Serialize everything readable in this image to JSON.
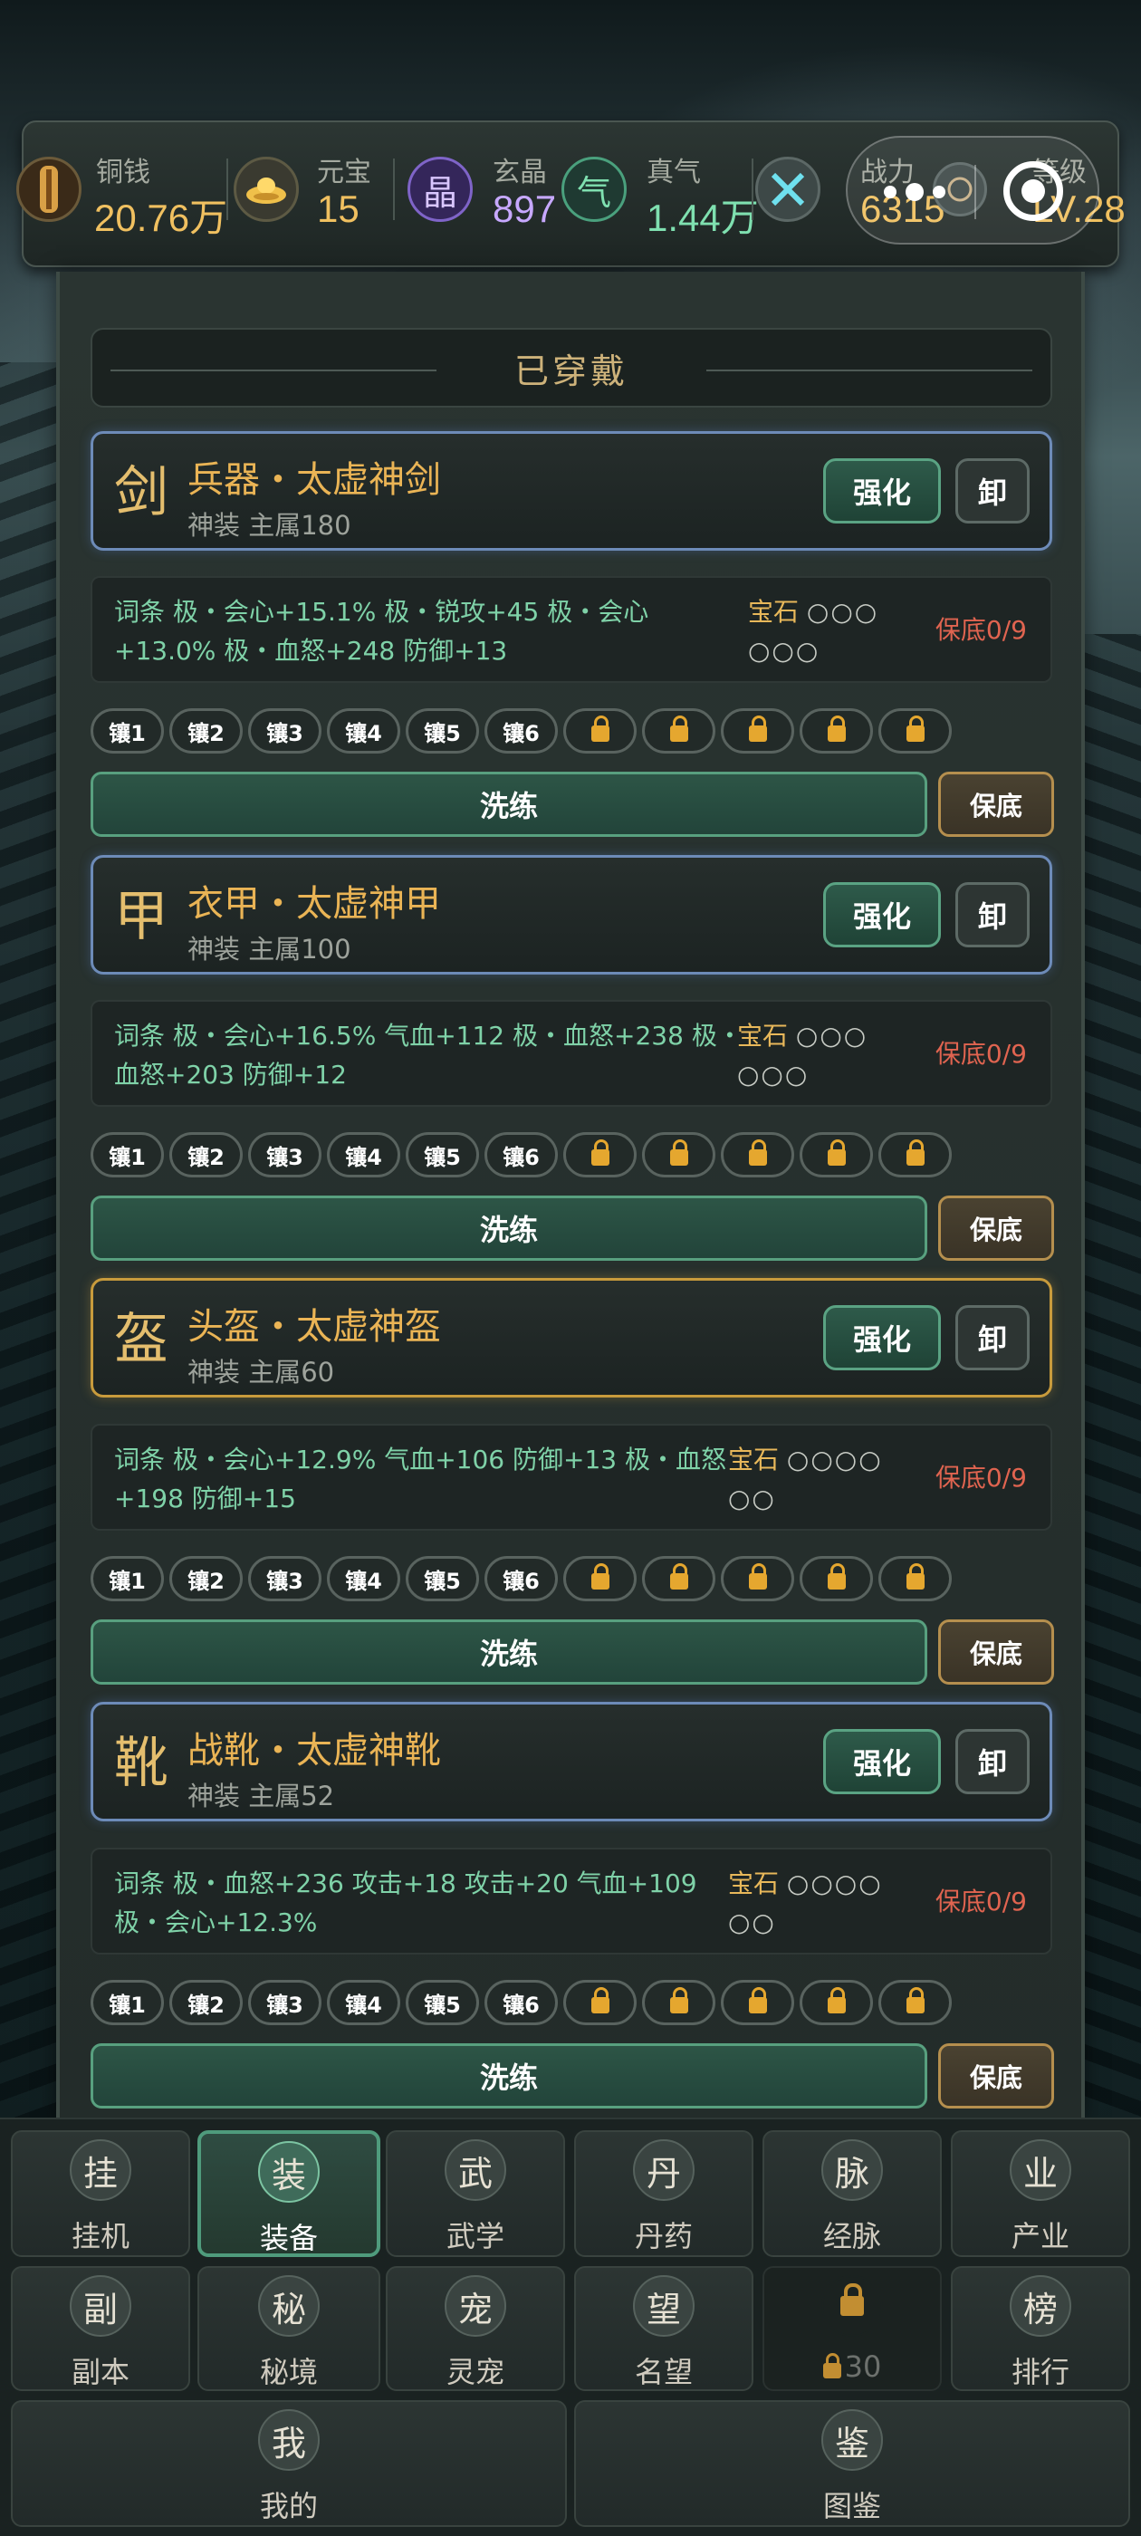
{
  "resources": [
    {
      "name": "铜钱",
      "value": "20.76万",
      "icon": "copper-coin-icon",
      "color": "#f0c060"
    },
    {
      "name": "元宝",
      "value": "15",
      "icon": "gold-ingot-icon",
      "color": "#f0c060"
    },
    {
      "name": "玄晶",
      "value": "897",
      "icon": "crystal-icon",
      "icon_text": "晶",
      "color": "#c7a8ff"
    },
    {
      "name": "真气",
      "value": "1.44万",
      "icon": "qi-icon",
      "icon_text": "气",
      "color": "#7fe0b0"
    },
    {
      "name": "战力",
      "value": "6315",
      "icon": "crossed-swords-icon",
      "color": "#f0c060"
    },
    {
      "name": "等级",
      "value": "LV.28",
      "icon": "level-icon",
      "color": "#f0c060"
    }
  ],
  "section_title": "已穿戴",
  "items": [
    {
      "glyph": "剑",
      "name": "兵器・太虚神剑",
      "sub": "神装 主属180",
      "border": "blue",
      "stats": "词条 极・会心+15.1% 极・锐攻+45 极・会心+13.0% 极・血怒+248 防御+13",
      "gem_label": "宝石",
      "gems": "○○○ ○○○",
      "floor": "保底0/9"
    },
    {
      "glyph": "甲",
      "name": "衣甲・太虚神甲",
      "sub": "神装 主属100",
      "border": "blue",
      "stats": "词条 极・会心+16.5% 气血+112 极・血怒+238 极・血怒+203 防御+12",
      "gem_label": "宝石",
      "gems": "○○○ ○○○",
      "floor": "保底0/9"
    },
    {
      "glyph": "盔",
      "name": "头盔・太虚神盔",
      "sub": "神装 主属60",
      "border": "gold",
      "stats": "词条 极・会心+12.9% 气血+106 防御+13 极・血怒+198 防御+15",
      "gem_label": "宝石",
      "gems": "○○○○ ○○",
      "floor": "保底0/9"
    },
    {
      "glyph": "靴",
      "name": "战靴・太虚神靴",
      "sub": "神装 主属52",
      "border": "blue",
      "stats": "词条 极・血怒+236 攻击+18 攻击+20 气血+109 极・会心+12.3%",
      "gem_label": "宝石",
      "gems": "○○○○ ○○",
      "floor": "保底0/9"
    }
  ],
  "buttons": {
    "enhance": "强化",
    "unequip": "卸",
    "wash": "洗练",
    "guarantee": "保底"
  },
  "slots": [
    "镶1",
    "镶2",
    "镶3",
    "镶4",
    "镶5",
    "镶6"
  ],
  "nav": [
    {
      "icon": "挂",
      "label": "挂机"
    },
    {
      "icon": "装",
      "label": "装备",
      "active": true
    },
    {
      "icon": "武",
      "label": "武学"
    },
    {
      "icon": "丹",
      "label": "丹药"
    },
    {
      "icon": "脉",
      "label": "经脉"
    },
    {
      "icon": "业",
      "label": "产业"
    },
    {
      "icon": "副",
      "label": "副本"
    },
    {
      "icon": "秘",
      "label": "秘境"
    },
    {
      "icon": "宠",
      "label": "灵宠"
    },
    {
      "icon": "望",
      "label": "名望"
    },
    {
      "icon": "",
      "label": "30",
      "locked": true
    },
    {
      "icon": "榜",
      "label": "排行"
    },
    {
      "icon": "我",
      "label": "我的"
    },
    {
      "icon": "鉴",
      "label": "图鉴"
    }
  ]
}
